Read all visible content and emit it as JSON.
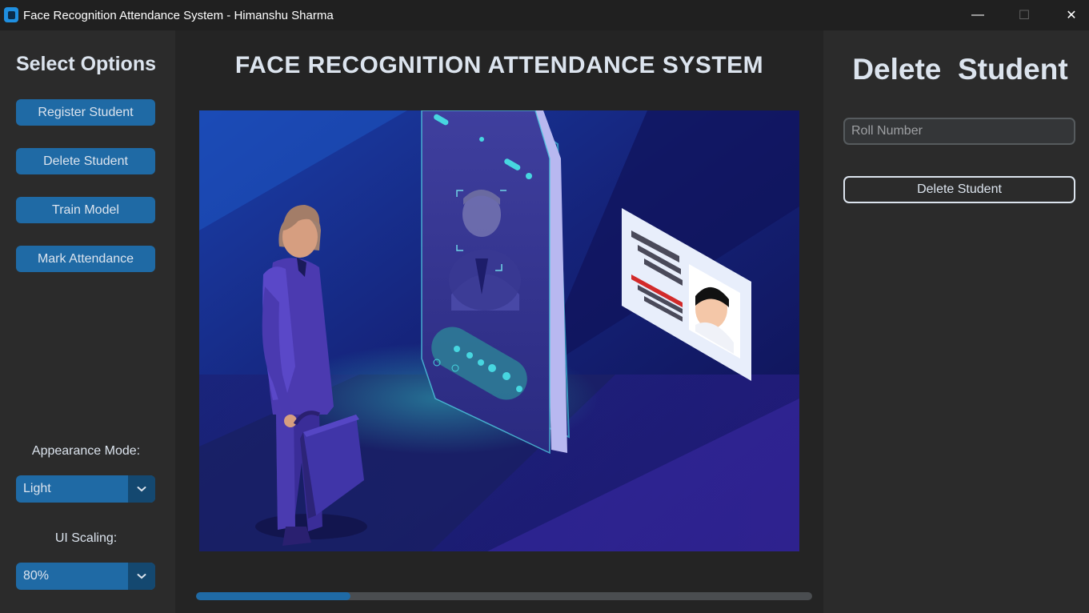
{
  "window": {
    "title": "Face Recognition Attendance System - Himanshu Sharma",
    "minimize_glyph": "—",
    "maximize_glyph": "☐",
    "close_glyph": "✕"
  },
  "sidebar": {
    "title": "Select Options",
    "buttons": [
      {
        "label": "Register Student"
      },
      {
        "label": "Delete Student"
      },
      {
        "label": "Train Model"
      },
      {
        "label": "Mark Attendance"
      }
    ],
    "appearance_label": "Appearance Mode:",
    "appearance_value": "Light",
    "scaling_label": "UI Scaling:",
    "scaling_value": "80%"
  },
  "main": {
    "title": "FACE RECOGNITION ATTENDANCE SYSTEM",
    "progress_fraction": 0.25
  },
  "right_panel": {
    "title": "Delete  Student",
    "roll_placeholder": "Roll Number",
    "roll_value": "",
    "delete_label": "Delete Student"
  },
  "colors": {
    "accent": "#1f6aa5",
    "accent_dark": "#144870",
    "sidebar_bg": "#2b2b2b",
    "main_bg": "#242424",
    "text": "#dce4ee"
  }
}
